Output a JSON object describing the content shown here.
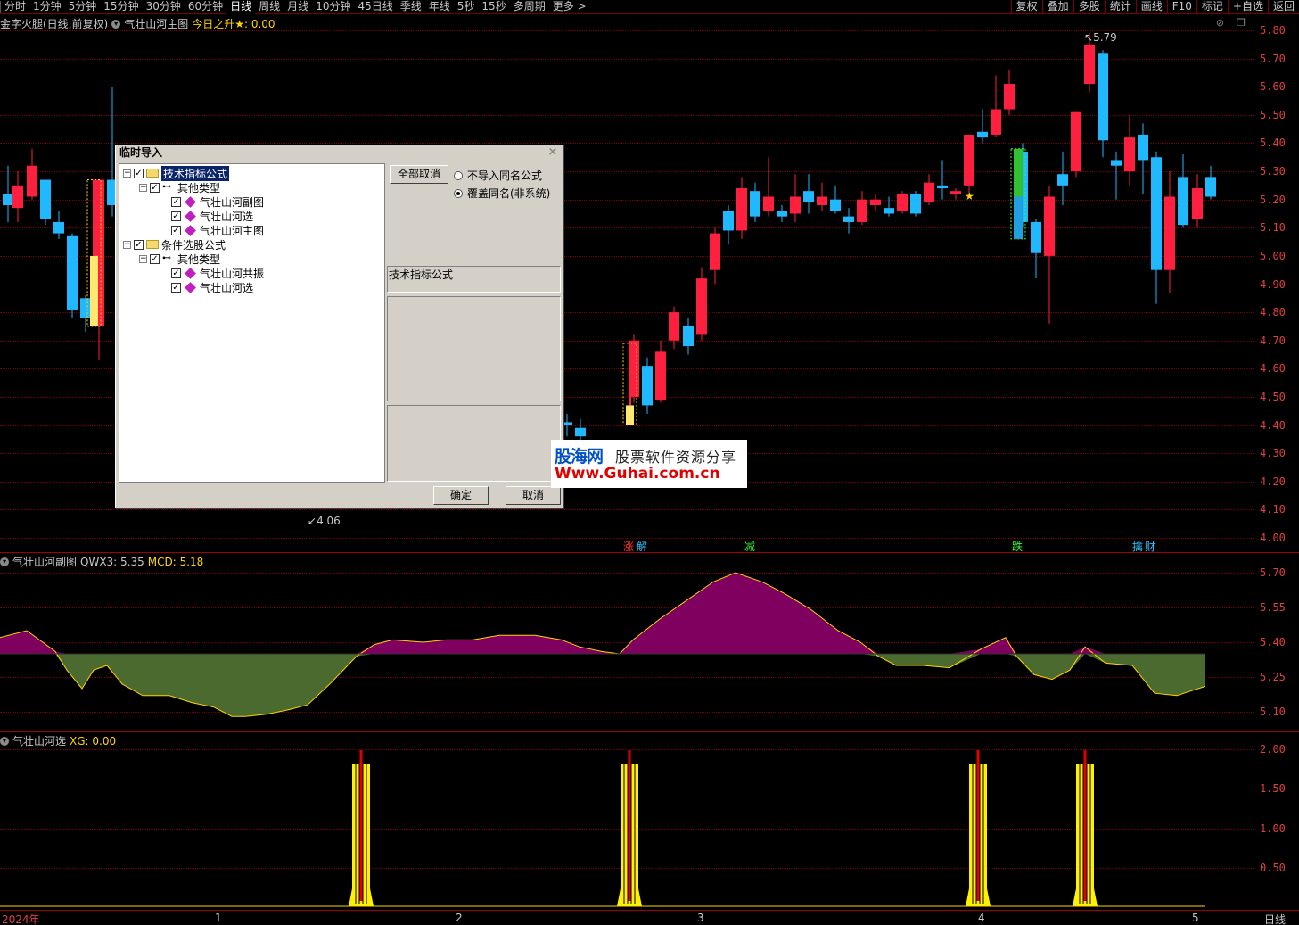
{
  "toolbar": {
    "periods": [
      "分时",
      "1分钟",
      "5分钟",
      "15分钟",
      "30分钟",
      "60分钟",
      "日线",
      "周线",
      "月线",
      "10分钟",
      "45日线",
      "季线",
      "年线",
      "5秒",
      "15秒",
      "多周期",
      "更多 >"
    ],
    "active_period": "日线",
    "right_buttons": [
      "复权",
      "叠加",
      "多股",
      "统计",
      "画线",
      "F10",
      "标记",
      "+自选",
      "返回"
    ]
  },
  "main_pane": {
    "stock_name": "金字火腿(日线,前复权)",
    "indicator": "气壮山河主图",
    "extra_label": "今日之升★: 0.00",
    "y_ticks": [
      "5.80",
      "5.70",
      "5.60",
      "5.50",
      "5.40",
      "5.30",
      "5.20",
      "5.10",
      "5.00",
      "4.90",
      "4.80",
      "4.70",
      "4.60",
      "4.50",
      "4.40",
      "4.30",
      "4.20",
      "4.10",
      "4.00"
    ],
    "high_label": "5.79",
    "low_label": "4.06",
    "signals": [
      {
        "text": "涨",
        "color": "#ff3030"
      },
      {
        "text": "解",
        "color": "#30c0ff"
      },
      {
        "text": "减",
        "color": "#30ff30"
      },
      {
        "text": "跌",
        "color": "#30ff30"
      },
      {
        "text": "擒",
        "color": "#30c0ff"
      },
      {
        "text": "财",
        "color": "#30c0ff"
      }
    ]
  },
  "sub_pane1": {
    "title": "气壮山河副图",
    "qwx3_label": "QWX3: 5.35",
    "mcd_label": "MCD: 5.18",
    "y_ticks": [
      "5.70",
      "5.55",
      "5.40",
      "5.25",
      "5.10"
    ]
  },
  "sub_pane2": {
    "title": "气壮山河选",
    "xg_label": "XG: 0.00",
    "y_ticks": [
      "2.00",
      "1.50",
      "1.00",
      "0.50"
    ]
  },
  "x_axis": {
    "labels": [
      "2024年",
      "1",
      "2",
      "3",
      "4",
      "5"
    ],
    "period_label": "日线"
  },
  "dialog": {
    "title": "临时导入",
    "close": "×",
    "tree": [
      {
        "label": "技术指标公式",
        "level": 0,
        "type": "folder",
        "selected": true
      },
      {
        "label": "其他类型",
        "level": 1,
        "type": "key"
      },
      {
        "label": "气壮山河副图",
        "level": 2,
        "type": "item"
      },
      {
        "label": "气壮山河选",
        "level": 2,
        "type": "item"
      },
      {
        "label": "气壮山河主图",
        "level": 2,
        "type": "item"
      },
      {
        "label": "条件选股公式",
        "level": 0,
        "type": "folder"
      },
      {
        "label": "其他类型",
        "level": 1,
        "type": "key"
      },
      {
        "label": "气壮山河共振",
        "level": 2,
        "type": "item"
      },
      {
        "label": "气壮山河选",
        "level": 2,
        "type": "item"
      }
    ],
    "cancel_all": "全部取消",
    "radio_no_import": "不导入同名公式",
    "radio_overwrite": "覆盖同名(非系统)",
    "category_label": "技术指标公式",
    "ok": "确定",
    "cancel": "取消"
  },
  "watermark": {
    "brand": "股海网",
    "slogan": "股票软件资源分享",
    "url": "Www.Guhai.com.cn"
  },
  "colors": {
    "up": "#ff2040",
    "down": "#20b8ff",
    "grid": "#7a0000",
    "axis": "#e04040",
    "mcd_fill_up": "#800060",
    "mcd_fill_down": "#4a6a30"
  }
}
